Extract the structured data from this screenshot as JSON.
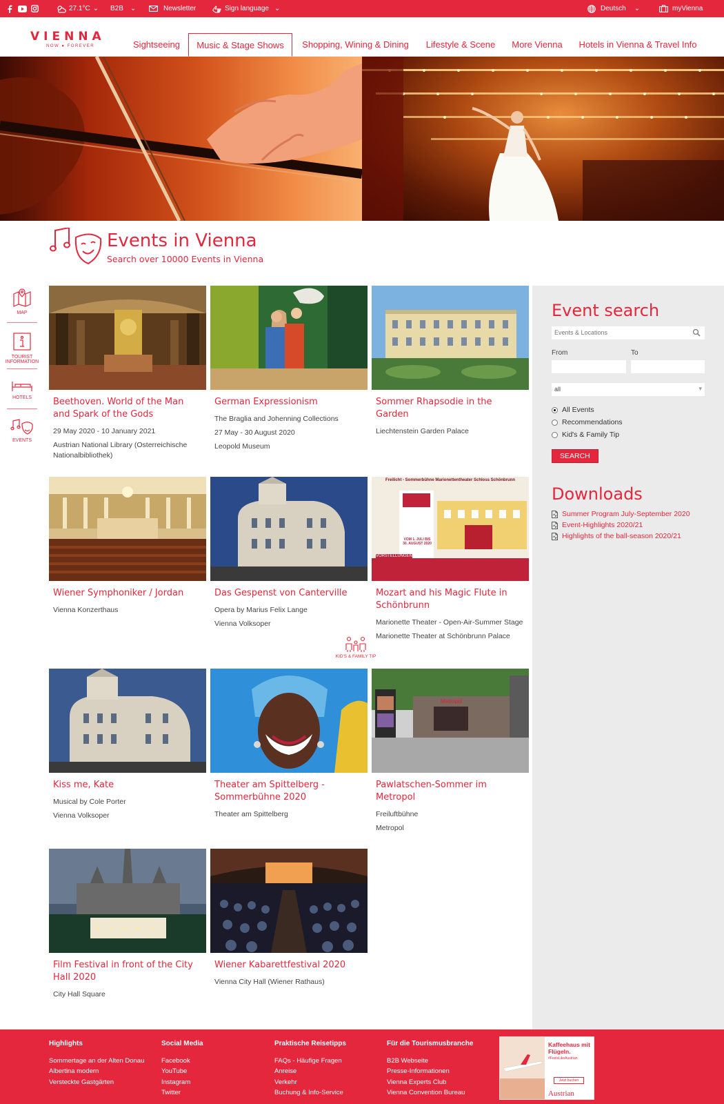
{
  "topbar": {
    "weather": "27.1°C",
    "b2b": "B2B",
    "newsletter": "Newsletter",
    "sign_language": "Sign language",
    "language": "Deutsch",
    "myvienna": "myVienna"
  },
  "brand": {
    "name": "VIENNA",
    "tagline": "NOW ● FOREVER"
  },
  "nav": [
    "Sightseeing",
    "Music & Stage Shows",
    "Shopping, Wining & Dining",
    "Lifestyle & Scene",
    "More Vienna",
    "Hotels in Vienna & Travel Info"
  ],
  "page": {
    "title": "Events in Vienna",
    "subtitle": "Search over 10000 Events in Vienna"
  },
  "sidenav": [
    {
      "label": "MAP",
      "icon": "map-icon"
    },
    {
      "label": "TOURIST INFORMATION",
      "icon": "info-icon"
    },
    {
      "label": "HOTELS",
      "icon": "bed-icon"
    },
    {
      "label": "EVENTS",
      "icon": "music-mask-icon"
    }
  ],
  "events": [
    {
      "title": "Beethoven. World of the Man and Spark of the Gods",
      "lines": [
        "29 May 2020 - 10 January 2021",
        "Austrian National Library (Osterreichische Nationalbibliothek)"
      ]
    },
    {
      "title": "German Expressionism",
      "lines": [
        "The Braglia and Johenning Collections",
        "27 May - 30 August 2020",
        "Leopold Museum"
      ]
    },
    {
      "title": "Sommer Rhapsodie in the Garden",
      "lines": [
        "Liechtenstein Garden Palace"
      ]
    },
    {
      "title": "Wiener Symphoniker / Jordan",
      "lines": [
        "Vienna Konzerthaus"
      ]
    },
    {
      "title": "Das Gespenst von Canterville",
      "lines": [
        "Opera by Marius Felix Lange",
        "Vienna Volksoper"
      ]
    },
    {
      "title": "Mozart and his Magic Flute in Schönbrunn",
      "lines": [
        "Marionette Theater - Open-Air-Summer Stage",
        "Marionette Theater at Schönbrunn Palace"
      ]
    },
    {
      "title": "Kiss me, Kate",
      "lines": [
        "Musical by Cole Porter",
        "Vienna Volksoper"
      ]
    },
    {
      "title": "Theater am Spittelberg - Sommerbühne 2020",
      "lines": [
        "Theater am Spittelberg"
      ]
    },
    {
      "title": "Pawlatschen-Sommer im Metropol",
      "lines": [
        "Freiluftbühne",
        "Metropol"
      ]
    },
    {
      "title": "Film Festival in front of the City Hall 2020",
      "lines": [
        "City Hall Square"
      ]
    },
    {
      "title": "Wiener Kabarettfestival 2020",
      "lines": [
        "Vienna City Hall (Wiener Rathaus)"
      ]
    }
  ],
  "badge": "KID'S & FAMILY TIP",
  "poster": {
    "header": "Freilicht - Sommerbühne Marionettentheater Schloss Schönbrunn",
    "dates": "VOM 1. JULI BIS 30. AUGUST 2020",
    "band": "VORSTELLUNGEN"
  },
  "search": {
    "title": "Event search",
    "placeholder": "Events & Locations",
    "from": "From",
    "to": "To",
    "select": "all",
    "radios": [
      "All Events",
      "Recommendations",
      "Kid's & Family Tip"
    ],
    "button": "SEARCH"
  },
  "downloads": {
    "title": "Downloads",
    "items": [
      "Summer Program July-September 2020",
      "Event-Highlights 2020/21",
      "Highlights of the ball-season 2020/21"
    ]
  },
  "footer": {
    "cols": [
      {
        "head": "Highlights",
        "items": [
          "Sommertage an der Alten Donau",
          "Albertina modern",
          "Versteckte Gastgärten"
        ]
      },
      {
        "head": "Social Media",
        "items": [
          "Facebook",
          "YouTube",
          "Instagram",
          "Twitter"
        ]
      },
      {
        "head": "Praktische Reisetipps",
        "items": [
          "FAQs - Häufige Fragen",
          "Anreise",
          "Verkehr",
          "Buchung & Info-Service"
        ]
      },
      {
        "head": "Für die Tourismusbranche",
        "items": [
          "B2B Webseite",
          "Presse-Informationen",
          "Vienna Experts Club",
          "Vienna Convention Bureau"
        ]
      }
    ],
    "ad": {
      "headline": "Kaffeehaus mit Flügeln.",
      "hashtag": "#FeelsLikeAustrian",
      "cta": "Jetzt buchen",
      "brand": "Austrian"
    }
  }
}
